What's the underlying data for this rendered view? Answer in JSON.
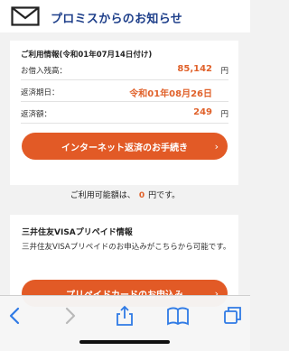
{
  "header": {
    "title": "プロミスからのお知らせ",
    "icon": "mail-icon"
  },
  "info": {
    "heading": "ご利用情報(令和01年07月14日付け)",
    "rows": [
      {
        "label": "お借入残高：",
        "value": "85,142",
        "unit": "円"
      },
      {
        "label": "返済期日：",
        "value": "令和01年08月26日",
        "unit": ""
      },
      {
        "label": "返済額：",
        "value": "249",
        "unit": "円"
      }
    ],
    "button": "インターネット返済のお手続き"
  },
  "available": {
    "prefix": "ご利用可能額は、",
    "amount": "0",
    "suffix": "円です。"
  },
  "prepaid": {
    "title": "三井住友VISAプリペイド情報",
    "desc": "三井住友VISAプリペイドのお申込みがこちらから可能です。",
    "button": "プリペイドカードのお申込み"
  },
  "colors": {
    "accent": "#e25a26",
    "brand": "#1e3f8a",
    "toolbar_icon": "#2f7ae5"
  }
}
